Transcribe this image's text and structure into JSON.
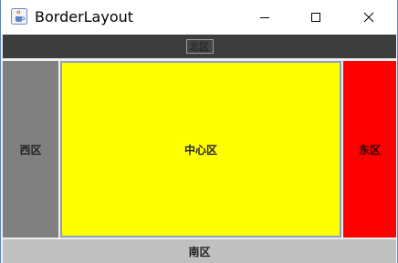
{
  "window": {
    "title": "BorderLayout",
    "icon": "java-cup-icon",
    "controls": [
      "minimize-icon",
      "maximize-icon",
      "close-icon"
    ]
  },
  "regions": {
    "north": {
      "label": "北区",
      "color": "#3d3d3d"
    },
    "west": {
      "label": "西区",
      "color": "#808080"
    },
    "center": {
      "label": "中心区",
      "color": "#ffff00"
    },
    "east": {
      "label": "东区",
      "color": "#ff0000"
    },
    "south": {
      "label": "南区",
      "color": "#c0c0c0"
    }
  }
}
